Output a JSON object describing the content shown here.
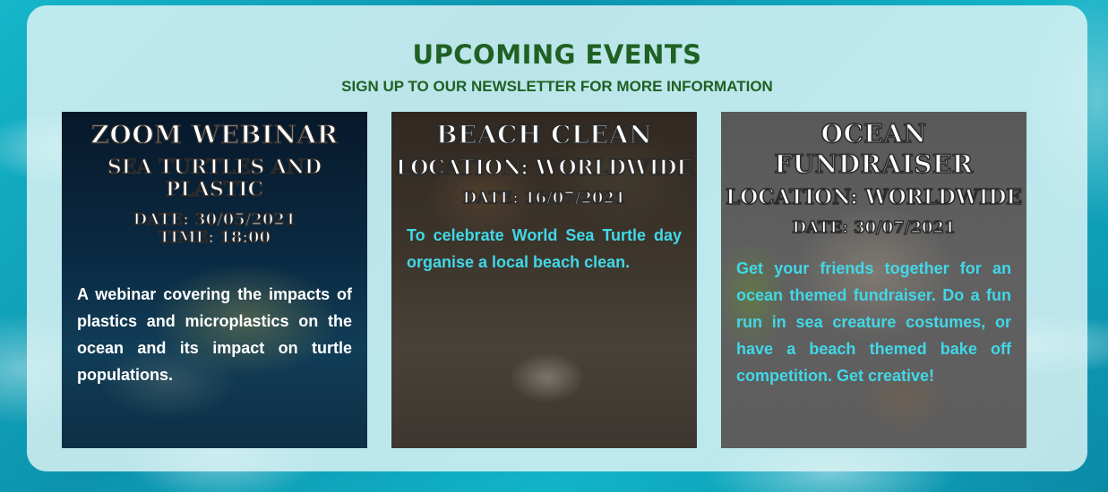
{
  "section": {
    "title": "UPCOMING EVENTS",
    "subtitle": "SIGN UP TO OUR NEWSLETTER FOR MORE INFORMATION"
  },
  "events": [
    {
      "title": "ZOOM WEBINAR",
      "subtitle": "SEA TURTLES AND PLASTIC",
      "date": "DATE: 30/05/2021",
      "time": "TIME: 18:00",
      "description": "A webinar covering the impacts of plastics and microplastics on the ocean and its impact on turtle populations."
    },
    {
      "title": "BEACH CLEAN",
      "location": "LOCATION: WORLDWIDE",
      "date": "DATE: 16/07/2021",
      "description": "To celebrate World Sea Turtle day organise a local beach clean."
    },
    {
      "title": "OCEAN FUNDRAISER",
      "location": "LOCATION: WORLDWIDE",
      "date": "DATE: 30/07/2021",
      "description": "Get your friends together for an ocean themed fundraiser. Do a fun run in sea creature costumes, or have a beach themed bake off competition. Get creative!"
    }
  ],
  "colors": {
    "heading": "#1f6122",
    "description_accent": "#41d8e8",
    "panel": "#def4f6"
  }
}
